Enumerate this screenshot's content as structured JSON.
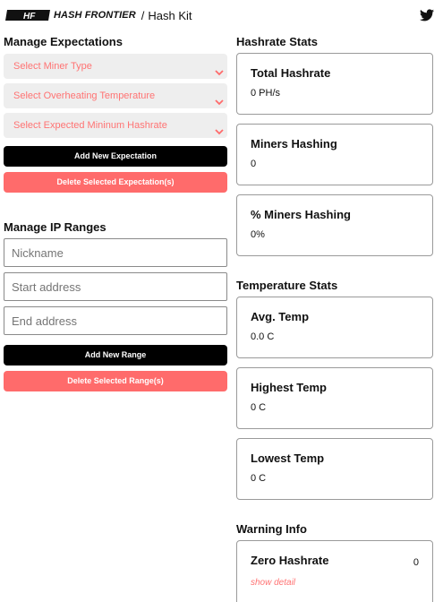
{
  "header": {
    "brand": "HASH FRONTIER",
    "separator": "/",
    "page": "Hash Kit"
  },
  "expectations": {
    "title": "Manage Expectations",
    "selects": [
      {
        "label": "Select Miner Type"
      },
      {
        "label": "Select Overheating Temperature"
      },
      {
        "label": "Select Expected Mininum Hashrate"
      }
    ],
    "add_button": "Add New Expectation",
    "delete_button": "Delete Selected Expectation(s)"
  },
  "ip_ranges": {
    "title": "Manage IP Ranges",
    "nickname_placeholder": "Nickname",
    "start_placeholder": "Start address",
    "end_placeholder": "End address",
    "add_button": "Add New Range",
    "delete_button": "Delete Selected Range(s)"
  },
  "hashrate_stats": {
    "title": "Hashrate Stats",
    "cards": [
      {
        "label": "Total Hashrate",
        "value": "0 PH/s"
      },
      {
        "label": "Miners Hashing",
        "value": "0"
      },
      {
        "label": "% Miners Hashing",
        "value": "0%"
      }
    ]
  },
  "temperature_stats": {
    "title": "Temperature Stats",
    "cards": [
      {
        "label": "Avg. Temp",
        "value": "0.0 C"
      },
      {
        "label": "Highest Temp",
        "value": "0 C"
      },
      {
        "label": "Lowest Temp",
        "value": "0 C"
      }
    ]
  },
  "warning_info": {
    "title": "Warning Info",
    "cards": [
      {
        "label": "Zero Hashrate",
        "count": "0",
        "link": "show detail"
      }
    ]
  },
  "colors": {
    "accent": "#ff6b6b",
    "accent_text": "#ff7373",
    "dark_button": "#000000",
    "select_bg": "#eeeeee"
  },
  "icons": {
    "logo": "hash-frontier-logo",
    "social": "twitter-icon",
    "select_arrow": "chevron-down-icon"
  }
}
